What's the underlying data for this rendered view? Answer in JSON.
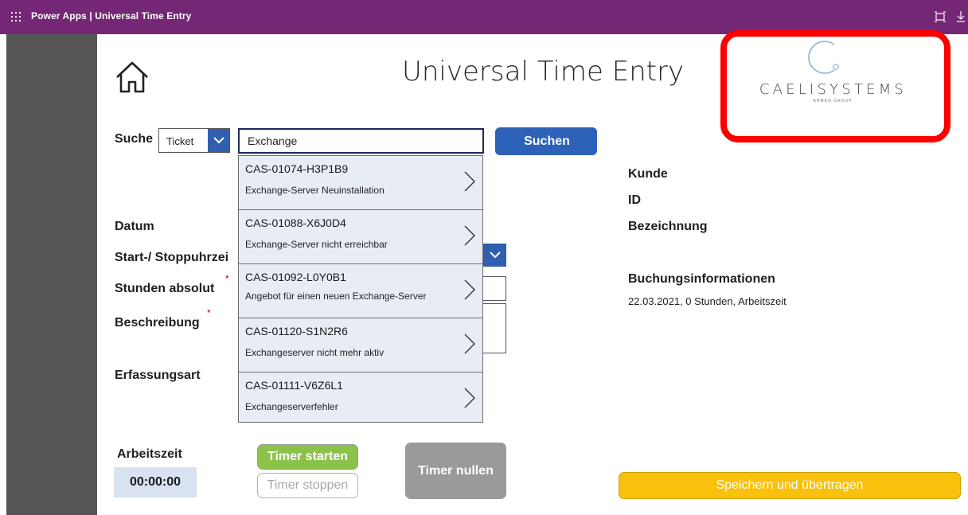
{
  "topbar": {
    "title": "Power Apps | Universal Time Entry"
  },
  "app": {
    "title": "Universal Time Entry"
  },
  "logo": {
    "name": "CAELISYSTEMS",
    "subtitle": "ARMEO GROUP"
  },
  "search": {
    "label": "Suche",
    "type_value": "Ticket",
    "query": "Exchange",
    "button_label": "Suchen"
  },
  "results": [
    {
      "code": "CAS-01074-H3P1B9",
      "desc": "Exchange-Server Neuinstallation"
    },
    {
      "code": "CAS-01088-X6J0D4",
      "desc": "Exchange-Server nicht erreichbar"
    },
    {
      "code": "CAS-01092-L0Y0B1",
      "desc": "Angebot für einen neuen Exchange-Server"
    },
    {
      "code": "CAS-01120-S1N2R6",
      "desc": "Exchangeserver nicht mehr aktiv"
    },
    {
      "code": "CAS-01111-V6Z6L1",
      "desc": "Exchangeserverfehler"
    }
  ],
  "form": {
    "datum_label": "Datum",
    "start_stop_label": "Start-/ Stoppuhrzei",
    "stunden_label": "Stunden absolut",
    "beschreibung_label": "Beschreibung",
    "erfassungsart_label": "Erfassungsart",
    "required_mark": "*"
  },
  "info": {
    "kunde_label": "Kunde",
    "id_label": "ID",
    "bezeichnung_label": "Bezeichnung",
    "buchung_label": "Buchungsinformationen",
    "buchung_text": "22.03.2021, 0 Stunden, Arbeitszeit"
  },
  "timer": {
    "label": "Arbeitszeit",
    "value": "00:00:00",
    "start_label": "Timer starten",
    "stop_label": "Timer stoppen",
    "reset_label": "Timer nullen"
  },
  "save": {
    "label": "Speichern und übertragen"
  },
  "colors": {
    "topbar": "#742774",
    "primary": "#2e62b8",
    "start": "#8bc34a",
    "save": "#f9c10c",
    "highlight_frame": "#ff0000"
  }
}
